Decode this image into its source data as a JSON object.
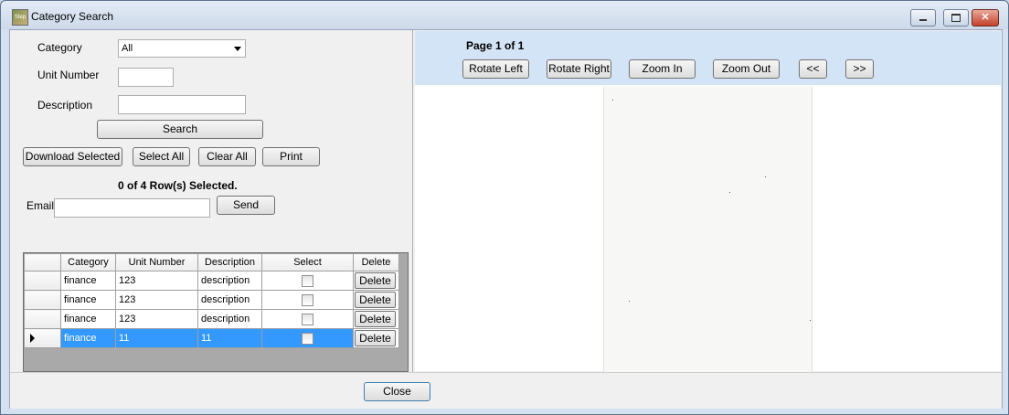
{
  "window": {
    "title": "Category Search",
    "icon_label": "Step",
    "minimize_label": "–",
    "maximize_label": "□",
    "close_label": "✕"
  },
  "search": {
    "category_label": "Category",
    "category_value": "All",
    "unit_number_label": "Unit Number",
    "unit_number_value": "",
    "description_label": "Description",
    "description_value": "",
    "search_button": "Search"
  },
  "actions": {
    "download_selected": "Download Selected",
    "select_all": "Select All",
    "clear_all": "Clear All",
    "print": "Print"
  },
  "selection_status": "0 of 4 Row(s) Selected.",
  "email": {
    "label": "Email",
    "value": "",
    "send_button": "Send"
  },
  "grid": {
    "columns": [
      "Category",
      "Unit Number",
      "Description",
      "Select",
      "Delete"
    ],
    "rows": [
      {
        "category": "finance",
        "unit_number": "123",
        "description": "description",
        "delete": "Delete",
        "selected": false
      },
      {
        "category": "finance",
        "unit_number": "123",
        "description": "description",
        "delete": "Delete",
        "selected": false
      },
      {
        "category": "finance",
        "unit_number": "123",
        "description": "description",
        "delete": "Delete",
        "selected": false
      },
      {
        "category": "finance",
        "unit_number": "11",
        "description": "11",
        "delete": "Delete",
        "selected": true
      }
    ]
  },
  "viewer": {
    "page_indicator": "Page 1 of 1",
    "rotate_left": "Rotate Left",
    "rotate_right": "Rotate Right",
    "zoom_in": "Zoom In",
    "zoom_out": "Zoom Out",
    "prev": "<<",
    "next": ">>"
  },
  "footer": {
    "close_button": "Close"
  },
  "colors": {
    "selection": "#3399ff",
    "viewer_toolbar": "#d4e4f7",
    "close_button_red": "#c5412b"
  }
}
